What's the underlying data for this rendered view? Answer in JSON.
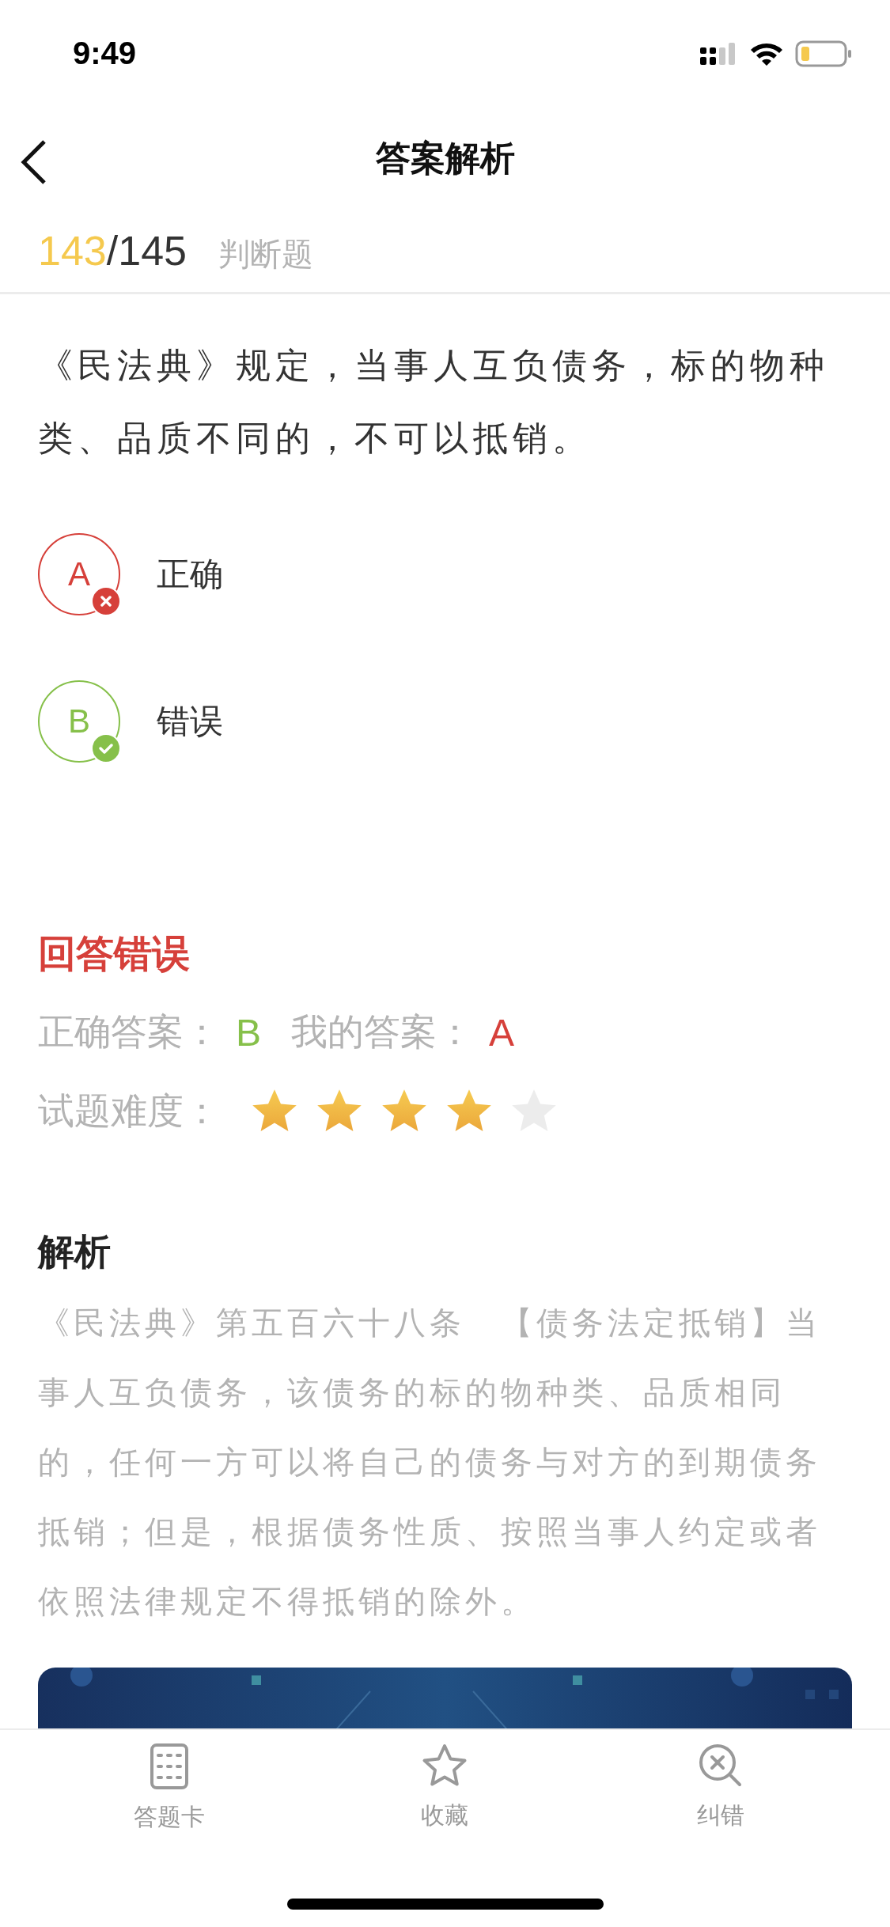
{
  "status_bar": {
    "time": "9:49"
  },
  "nav": {
    "title": "答案解析"
  },
  "progress": {
    "current": "143",
    "total": "/145",
    "type": "判断题"
  },
  "question": {
    "text": "《民法典》规定，当事人互负债务，标的物种类、品质不同的，不可以抵销。"
  },
  "options": [
    {
      "letter": "A",
      "text": "正确",
      "correct": false
    },
    {
      "letter": "B",
      "text": "错误",
      "correct": true
    }
  ],
  "result": {
    "verdict": "回答错误",
    "correct_label": "正确答案：",
    "correct_answer": "B",
    "my_label": "我的答案：",
    "my_answer": "A",
    "difficulty_label": "试题难度：",
    "stars": 4
  },
  "analysis": {
    "title": "解析",
    "text": "《民法典》第五百六十八条　【债务法定抵销】当事人互负债务，该债务的标的物种类、品质相同的，任何一方可以将自己的债务与对方的到期债务抵销；但是，根据债务性质、按照当事人约定或者依照法律规定不得抵销的除外。"
  },
  "tab_bar": [
    {
      "label": "答题卡",
      "kind": "card"
    },
    {
      "label": "收藏",
      "kind": "star"
    },
    {
      "label": "纠错",
      "kind": "report"
    }
  ]
}
